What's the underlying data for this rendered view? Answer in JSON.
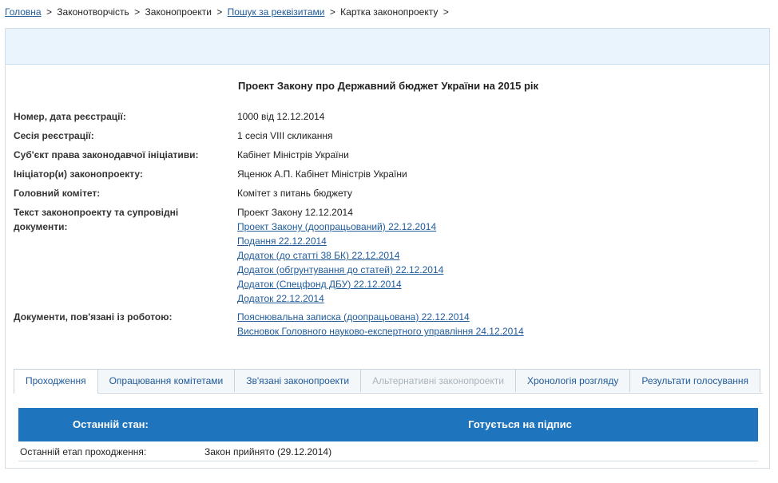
{
  "breadcrumb": {
    "home": "Головна",
    "item2": "Законотворчість",
    "item3": "Законопроекти",
    "item4": "Пошук за реквізитами",
    "item5": "Картка законопроекту",
    "separator": ">"
  },
  "bill": {
    "title": "Проект Закону про Державний бюджет України на 2015 рік",
    "fields": {
      "reg_number": {
        "label": "Номер, дата реєстрації:",
        "value": "1000 від 12.12.2014"
      },
      "session": {
        "label": "Сесія реєстрації:",
        "value": "1 сесія VIII скликання"
      },
      "subject": {
        "label": "Суб'єкт права законодавчої ініціативи:",
        "value": "Кабінет Міністрів України"
      },
      "initiator": {
        "label": "Ініціатор(и) законопроекту:",
        "value": "Яценюк А.П. Кабінет Міністрів України"
      },
      "committee": {
        "label": "Головний комітет:",
        "value": "Комітет з питань бюджету"
      },
      "texts": {
        "label_line1": "Текст законопроекту та супровідні",
        "label_line2": "документи:",
        "plain": "Проект Закону 12.12.2014",
        "links": [
          "Проект Закону (доопрацьований) 22.12.2014",
          "Подання 22.12.2014",
          "Додаток (до статті 38 БК) 22.12.2014",
          "Додаток (обгрунтування до статей) 22.12.2014",
          "Додаток (Спецфонд ДБУ) 22.12.2014",
          "Додаток 22.12.2014"
        ]
      },
      "related_docs": {
        "label": "Документи, пов'язані із роботою:",
        "links": [
          "Пояснювальна записка (доопрацьована) 22.12.2014",
          "Висновок Головного науково-експертного управління 24.12.2014"
        ]
      }
    }
  },
  "tabs": [
    {
      "label": "Проходження",
      "state": "active"
    },
    {
      "label": "Опрацювання комітетами",
      "state": "normal"
    },
    {
      "label": "Зв'язані законопроекти",
      "state": "normal"
    },
    {
      "label": "Альтернативні законопроекти",
      "state": "disabled"
    },
    {
      "label": "Хронологія розгляду",
      "state": "normal"
    },
    {
      "label": "Результати голосування",
      "state": "normal"
    }
  ],
  "status": {
    "last_state_label": "Останній стан:",
    "last_state_value": "Готується на підпис",
    "last_stage_label": "Останній етап проходження:",
    "last_stage_value": "Закон прийнято (29.12.2014)"
  },
  "colors": {
    "link": "#1f5a99",
    "header_bg": "#eaf4fc",
    "state_bar": "#1f74be"
  }
}
